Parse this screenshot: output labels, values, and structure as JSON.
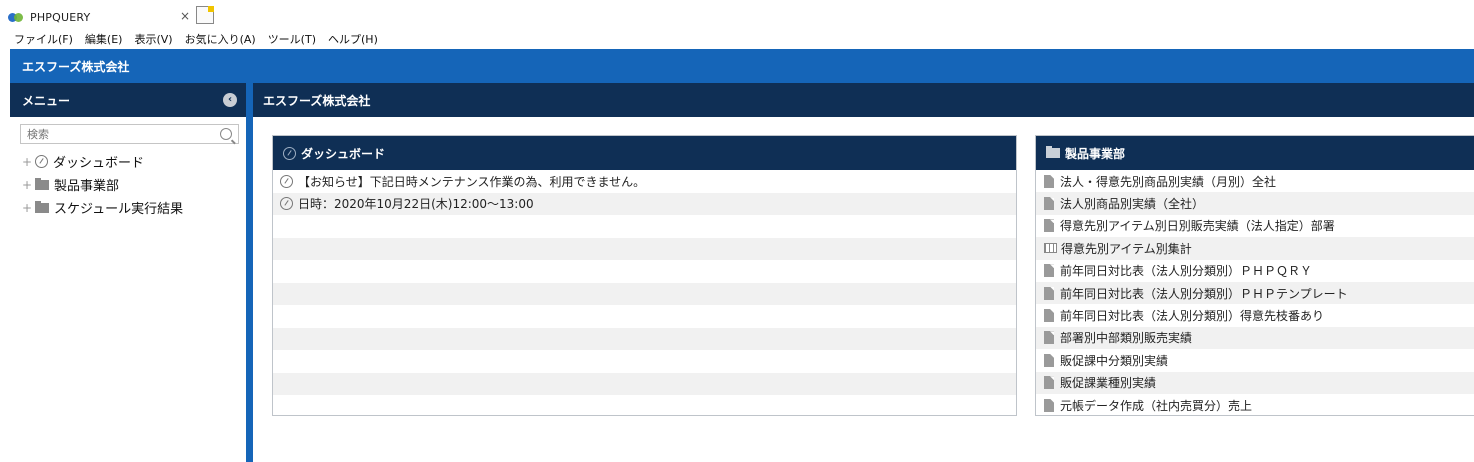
{
  "browser": {
    "tab_title": "PHPQUERY",
    "close_glyph": "×"
  },
  "menubar": [
    "ファイル(F)",
    "編集(E)",
    "表示(V)",
    "お気に入り(A)",
    "ツール(T)",
    "ヘルプ(H)"
  ],
  "app": {
    "company": "エスフーズ株式会社"
  },
  "sidebar": {
    "title": "メニュー",
    "search_placeholder": "検索",
    "items": [
      {
        "label": "ダッシュボード",
        "icon": "gauge-icon"
      },
      {
        "label": "製品事業部",
        "icon": "folder-icon"
      },
      {
        "label": "スケジュール実行結果",
        "icon": "folder-icon"
      }
    ]
  },
  "main": {
    "title": "エスフーズ株式会社"
  },
  "dashboard": {
    "title": "ダッシュボード",
    "rows": [
      "【お知らせ】下記日時メンテナンス作業の為、利用できません。",
      "日時：2020年10月22日(木)12:00～13:00",
      "",
      "",
      "",
      "",
      "",
      "",
      "",
      "",
      ""
    ]
  },
  "products": {
    "title": "製品事業部",
    "items": [
      {
        "label": "法人・得意先別商品別実績（月別）全社",
        "icon": "doc-icon"
      },
      {
        "label": "法人別商品別実績（全社）",
        "icon": "doc-icon"
      },
      {
        "label": "得意先別アイテム別日別販売実績（法人指定）部署",
        "icon": "doc-icon"
      },
      {
        "label": "得意先別アイテム別集計",
        "icon": "table-icon"
      },
      {
        "label": "前年同日対比表（法人別分類別）ＰＨＰＱＲＹ",
        "icon": "doc-icon"
      },
      {
        "label": "前年同日対比表（法人別分類別）ＰＨＰテンプレート",
        "icon": "doc-icon"
      },
      {
        "label": "前年同日対比表（法人別分類別）得意先枝番あり",
        "icon": "doc-icon"
      },
      {
        "label": "部署別中部類別販売実績",
        "icon": "doc-icon"
      },
      {
        "label": "販促課中分類別実績",
        "icon": "doc-icon"
      },
      {
        "label": "販促課業種別実績",
        "icon": "doc-icon"
      },
      {
        "label": "元帳データ作成（社内売買分）売上",
        "icon": "doc-icon"
      }
    ]
  }
}
